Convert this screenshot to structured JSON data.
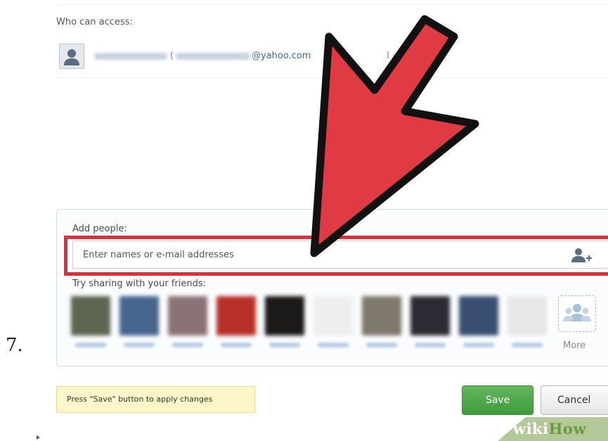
{
  "access": {
    "label": "Who can access:",
    "user": {
      "paren": "(",
      "email_suffix": "@yahoo.com"
    },
    "role_initial": "I"
  },
  "add_people": {
    "label": "Add people:",
    "input_placeholder": "Enter names or e-mail addresses",
    "try_label": "Try sharing with your friends:",
    "more_label": "More"
  },
  "footer": {
    "hint": "Press \"Save\" button to apply changes",
    "save_label": "Save",
    "cancel_label": "Cancel"
  },
  "step_number": "7.",
  "watermark": {
    "wiki": "wiki",
    "how": "How"
  },
  "colors": {
    "highlight": "#d9303c",
    "arrow": "#e03a45",
    "save": "#4caa45",
    "link": "#3b6aa0"
  },
  "icons": {
    "avatar": "person-silhouette-icon",
    "add_person": "add-person-icon",
    "more": "group-icon",
    "arrow": "red-pointer-arrow"
  }
}
